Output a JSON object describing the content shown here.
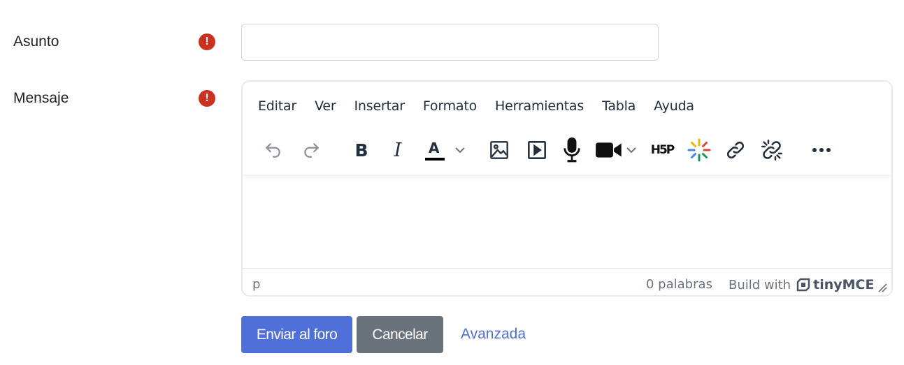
{
  "form": {
    "subject_label": "Asunto",
    "message_label": "Mensaje",
    "required_mark": "!",
    "subject_value": "",
    "subject_placeholder": ""
  },
  "editor": {
    "menu": [
      "Editar",
      "Ver",
      "Insertar",
      "Formato",
      "Herramientas",
      "Tabla",
      "Ayuda"
    ],
    "toolbar_icons": [
      "undo-icon",
      "redo-icon",
      "bold-icon",
      "italic-icon",
      "text-color-icon",
      "chevron-down-icon",
      "image-icon",
      "media-icon",
      "microphone-icon",
      "video-camera-icon",
      "chevron-down-icon",
      "h5p-icon",
      "ai-sparkle-icon",
      "link-icon",
      "unlink-icon",
      "more-icon"
    ],
    "bold_glyph": "B",
    "italic_glyph": "I",
    "text_color_glyph": "A",
    "h5p_label": "H5P",
    "status": {
      "path": "p",
      "words": "0 palabras",
      "build_with": "Build with",
      "brand": "tinyMCE"
    }
  },
  "buttons": {
    "submit": "Enviar al foro",
    "cancel": "Cancelar",
    "advanced": "Avanzada"
  },
  "colors": {
    "primary": "#4f6fd9",
    "secondary": "#6a737b",
    "required": "#ca3120"
  }
}
